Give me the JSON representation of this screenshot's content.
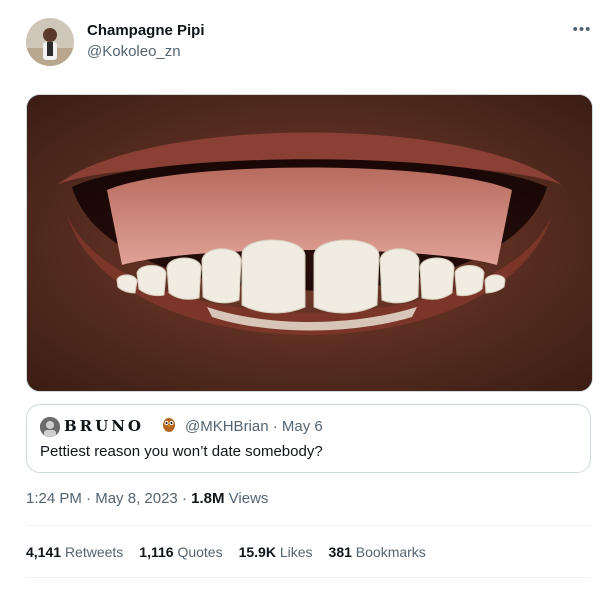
{
  "author": {
    "name": "Champagne Pipi",
    "handle": "@Kokoleo_zn",
    "avatar_icon": "profile-photo"
  },
  "menu_icon": "more-icon",
  "media": {
    "icon": "photo-smile-teeth",
    "colors": {
      "skin": "#5a2f22",
      "lips": "#8a4034",
      "gums": "#d0867a",
      "teeth": "#f1ece1"
    }
  },
  "quoted_tweet": {
    "name": "BRUNO",
    "emoji": "owl-emoji",
    "handle": "@MKHBrian",
    "separator": " · ",
    "date": "May 6",
    "text": "Pettiest reason you won’t date somebody?"
  },
  "meta": {
    "time": "1:24 PM",
    "separator": " · ",
    "date": "May 8, 2023",
    "views_count": "1.8M",
    "views_label": "Views"
  },
  "stats": [
    {
      "count": "4,141",
      "label": "Retweets"
    },
    {
      "count": "1,116",
      "label": "Quotes"
    },
    {
      "count": "15.9K",
      "label": "Likes"
    },
    {
      "count": "381",
      "label": "Bookmarks"
    }
  ],
  "colors": {
    "secondary_text": "#536471",
    "primary_text": "#0f1419",
    "border": "#cfd9de"
  }
}
